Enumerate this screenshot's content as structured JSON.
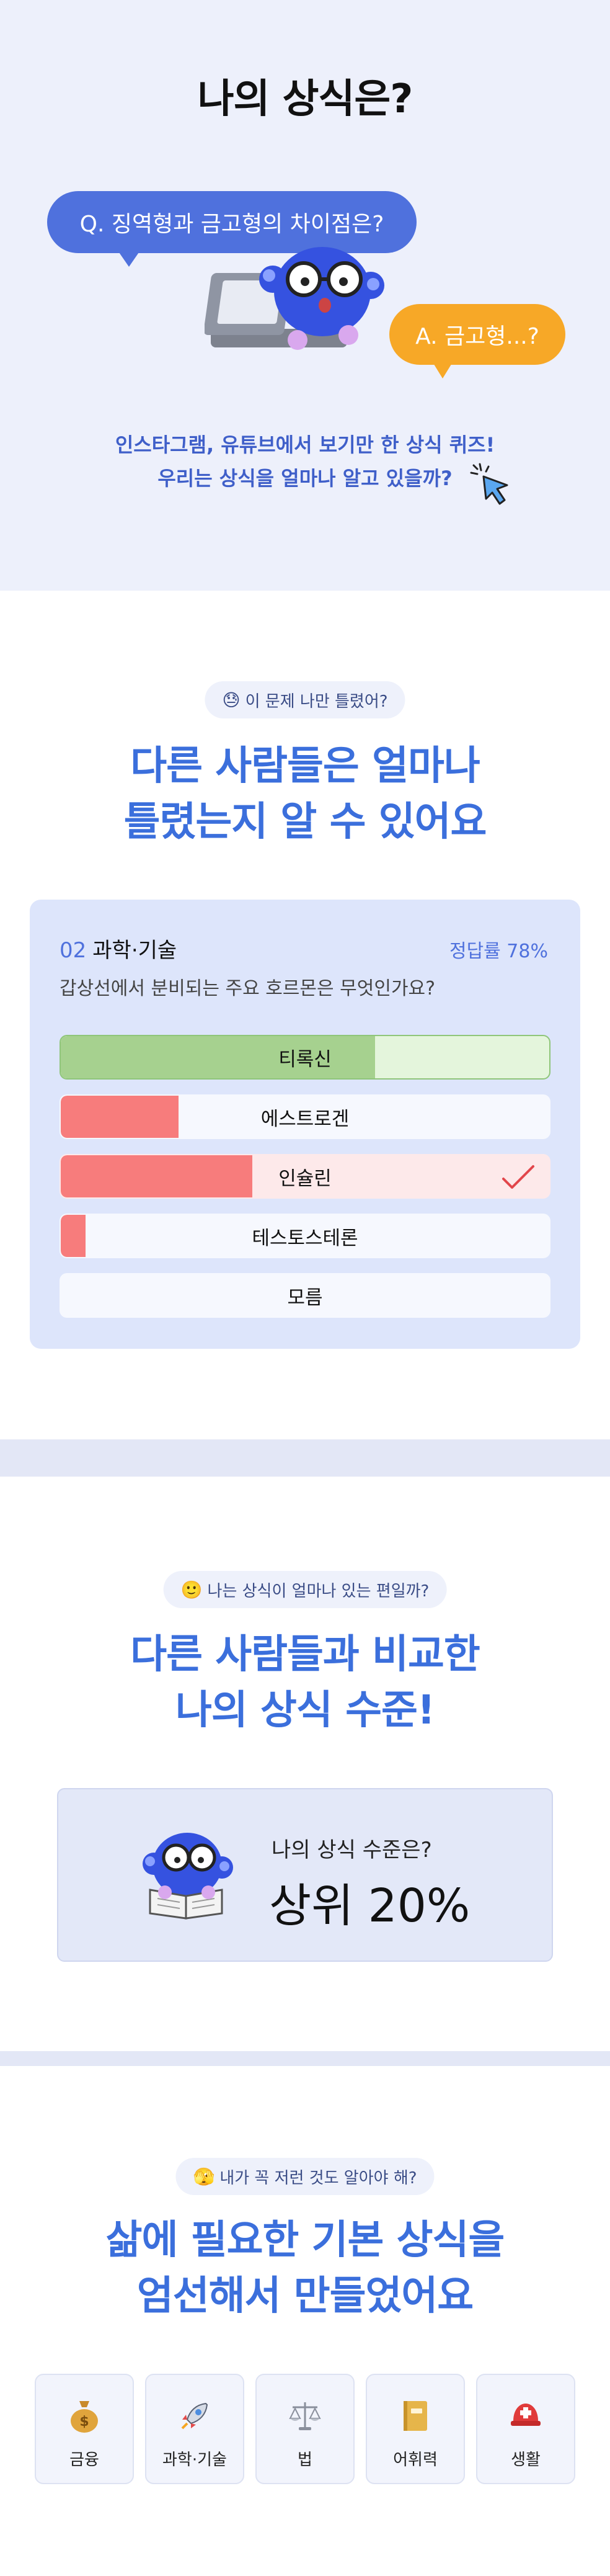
{
  "hero": {
    "title": "나의 상식은?",
    "question_bubble": "Q. 징역형과 금고형의 차이점은?",
    "answer_bubble": "A. 금고형...?",
    "desc_line1": "인스타그램, 유튜브에서 보기만 한 상식 퀴즈!",
    "desc_line2": "우리는 상식을 얼마나 알고 있을까?"
  },
  "section_wrong": {
    "pill_emoji": "😓",
    "pill_text": "이 문제 나만 틀렸어?",
    "title_line1": "다른 사람들은 얼마나",
    "title_line2": "틀렸는지 알 수 있어요",
    "quiz": {
      "number": "02",
      "category": "과학·기술",
      "rate": "정답률 78%",
      "question": "갑상선에서 분비되는 주요 호르몬은 무엇인가요?",
      "options": [
        {
          "label": "티록신",
          "share": 0.64,
          "state": "correct"
        },
        {
          "label": "에스트로겐",
          "share": 0.24,
          "state": "other"
        },
        {
          "label": "인슐린",
          "share": 0.39,
          "state": "selected"
        },
        {
          "label": "테스토스테론",
          "share": 0.05,
          "state": "other"
        },
        {
          "label": "모름",
          "share": 0,
          "state": "other"
        }
      ]
    }
  },
  "section_rank": {
    "pill_emoji": "🙂",
    "pill_text": "나는 상식이 얼마나 있는 편일까?",
    "title_line1": "다른 사람들과 비교한",
    "title_line2": "나의 상식 수준!",
    "rank_label": "나의 상식 수준은?",
    "rank_value": "상위 20%"
  },
  "section_topics": {
    "pill_emoji": "🫣",
    "pill_text": "내가 꼭 저런 것도 알아야 해?",
    "title_line1": "삶에 필요한 기본 상식을",
    "title_line2": "엄선해서 만들었어요",
    "categories": [
      {
        "label": "금융",
        "icon": "money-bag-icon"
      },
      {
        "label": "과학·기술",
        "icon": "rocket-icon"
      },
      {
        "label": "법",
        "icon": "scales-icon"
      },
      {
        "label": "어휘력",
        "icon": "book-icon"
      },
      {
        "label": "생활",
        "icon": "helmet-icon"
      }
    ]
  },
  "colors": {
    "accent": "#3b6fdc",
    "correct_fill": "#a6d18f",
    "correct_bg": "#e4f5dc",
    "wrong_fill": "#f77c7c",
    "selected_bg": "#fde9ea",
    "orange": "#f7a827"
  }
}
